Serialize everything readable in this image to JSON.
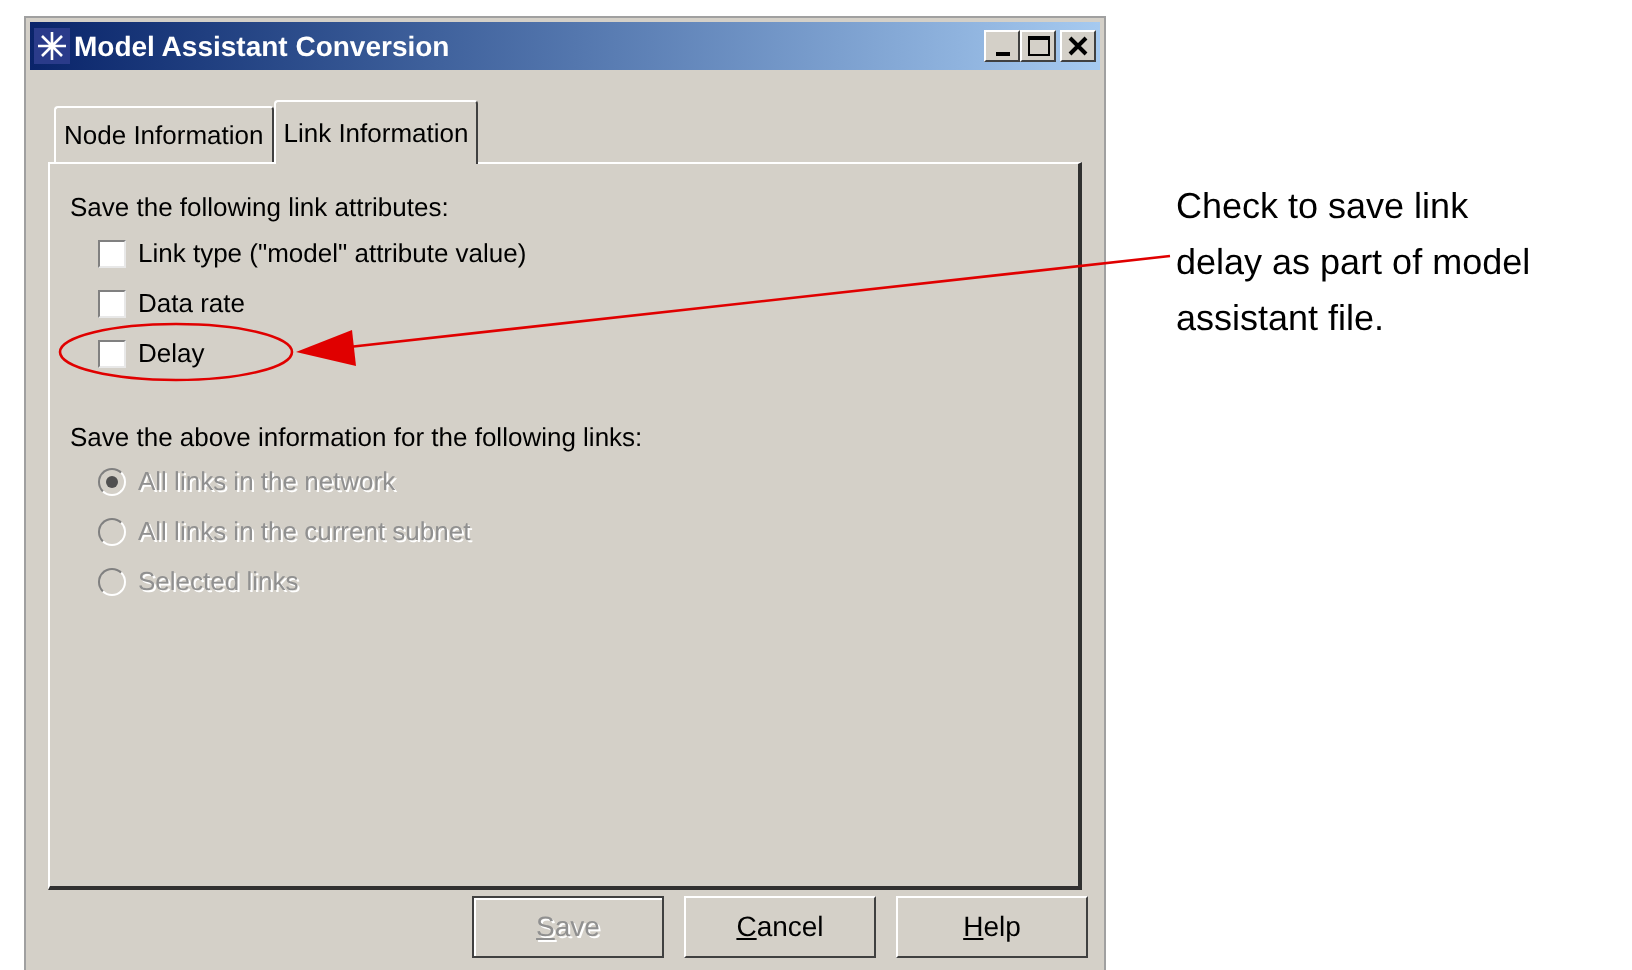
{
  "window": {
    "title": "Model Assistant Conversion"
  },
  "tabs": [
    {
      "label": "Node Information",
      "selected": false
    },
    {
      "label": "Link Information",
      "selected": true
    }
  ],
  "attributes": {
    "heading": "Save the following link attributes:",
    "checkboxes": [
      {
        "label": "Link type (\"model\" attribute value)",
        "checked": false,
        "highlighted": false
      },
      {
        "label": "Data rate",
        "checked": false,
        "highlighted": false
      },
      {
        "label": "Delay",
        "checked": false,
        "highlighted": true
      }
    ]
  },
  "scope": {
    "heading": "Save the above information for the following links:",
    "radios": [
      {
        "label": "All links in the network",
        "selected": true,
        "disabled": true
      },
      {
        "label": "All links in the current subnet",
        "selected": false,
        "disabled": true
      },
      {
        "label": "Selected links",
        "selected": false,
        "disabled": true
      }
    ]
  },
  "buttons": [
    {
      "label": "Save",
      "disabled": true
    },
    {
      "label": "Cancel",
      "disabled": false
    },
    {
      "label": "Help",
      "disabled": false
    }
  ],
  "callout": {
    "text": "Check to save link delay as part of model assistant file."
  }
}
